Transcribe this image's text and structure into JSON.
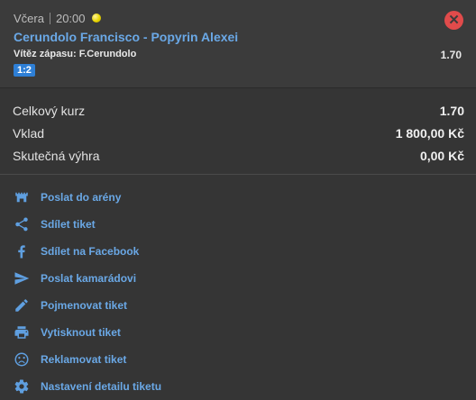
{
  "bet": {
    "day": "Včera",
    "time": "20:00",
    "close_symbol": "✕",
    "match": "Cerundolo Francisco - Popyrin Alexei",
    "pick": "Vítěz zápasu: F.Cerundolo",
    "odd": "1.70",
    "score_badge": "1:2"
  },
  "summary": {
    "rows": [
      {
        "label": "Celkový kurz",
        "value": "1.70"
      },
      {
        "label": "Vklad",
        "value": "1 800,00 Kč"
      },
      {
        "label": "Skutečná výhra",
        "value": "0,00 Kč"
      }
    ]
  },
  "actions": [
    {
      "label": "Poslat do arény",
      "icon": "arena-icon"
    },
    {
      "label": "Sdílet tiket",
      "icon": "share-icon"
    },
    {
      "label": "Sdílet na Facebook",
      "icon": "facebook-icon"
    },
    {
      "label": "Poslat kamarádovi",
      "icon": "send-icon"
    },
    {
      "label": "Pojmenovat tiket",
      "icon": "pencil-icon"
    },
    {
      "label": "Vytisknout tiket",
      "icon": "printer-icon"
    },
    {
      "label": "Reklamovat tiket",
      "icon": "sad-face-icon"
    },
    {
      "label": "Nastavení detailu tiketu",
      "icon": "gear-icon"
    }
  ],
  "colors": {
    "accent": "#6aa8e6",
    "close": "#e04b4b",
    "badge": "#2e7fd6"
  }
}
